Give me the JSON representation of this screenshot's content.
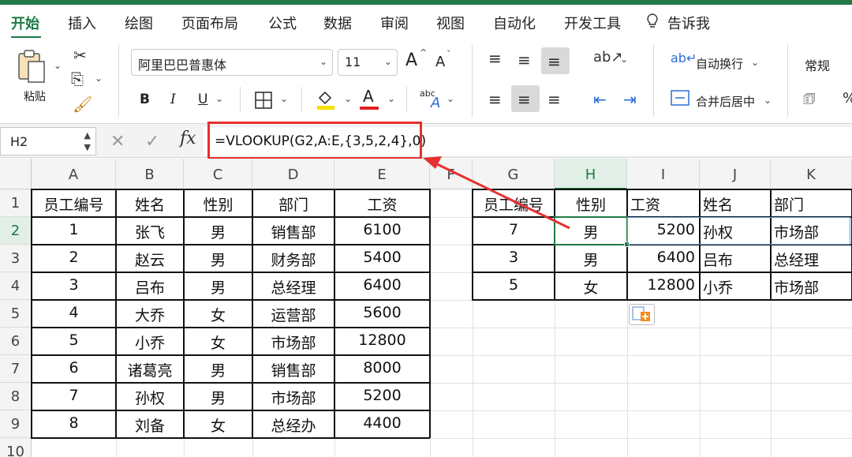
{
  "ribbon_tabs": [
    "开始",
    "插入",
    "绘图",
    "页面布局",
    "公式",
    "数据",
    "审阅",
    "视图",
    "自动化",
    "开发工具",
    "告诉我"
  ],
  "ribbon": {
    "paste_label": "粘贴",
    "font_name": "阿里巴巴普惠体",
    "font_size": "11",
    "wrap_text": "自动换行",
    "merge_center": "合并后居中",
    "number_format": "常规",
    "bold": "B",
    "italic": "I",
    "underline": "U",
    "font_color_letter": "A",
    "grow_font": "A",
    "shrink_font": "A",
    "abc_label": "abc",
    "font_color": "#e02020",
    "highlight_color": "#f5e000"
  },
  "formula_bar": {
    "cell_ref": "H2",
    "formula": "=VLOOKUP(G2,A:E,{3,5,2,4},0)",
    "fx": "fx"
  },
  "columns": [
    "A",
    "B",
    "C",
    "D",
    "E",
    "F",
    "G",
    "H",
    "I",
    "J",
    "K"
  ],
  "rows": [
    "1",
    "2",
    "3",
    "4",
    "5",
    "6",
    "7",
    "8",
    "9",
    "10"
  ],
  "source_table": {
    "headers": [
      "员工编号",
      "姓名",
      "性别",
      "部门",
      "工资"
    ],
    "rows": [
      [
        "1",
        "张飞",
        "男",
        "销售部",
        "6100"
      ],
      [
        "2",
        "赵云",
        "男",
        "财务部",
        "5400"
      ],
      [
        "3",
        "吕布",
        "男",
        "总经理",
        "6400"
      ],
      [
        "4",
        "大乔",
        "女",
        "运营部",
        "5600"
      ],
      [
        "5",
        "小乔",
        "女",
        "市场部",
        "12800"
      ],
      [
        "6",
        "诸葛亮",
        "男",
        "销售部",
        "8000"
      ],
      [
        "7",
        "孙权",
        "男",
        "市场部",
        "5200"
      ],
      [
        "8",
        "刘备",
        "女",
        "总经办",
        "4400"
      ]
    ]
  },
  "lookup_table": {
    "headers": [
      "员工编号",
      "性别",
      "工资",
      "姓名",
      "部门"
    ],
    "rows": [
      [
        "7",
        "男",
        "5200",
        "孙权",
        "市场部"
      ],
      [
        "3",
        "男",
        "6400",
        "吕布",
        "总经理"
      ],
      [
        "5",
        "女",
        "12800",
        "小乔",
        "市场部"
      ]
    ]
  },
  "accent_color": "#1f7a45",
  "annotation_color": "#e53030"
}
